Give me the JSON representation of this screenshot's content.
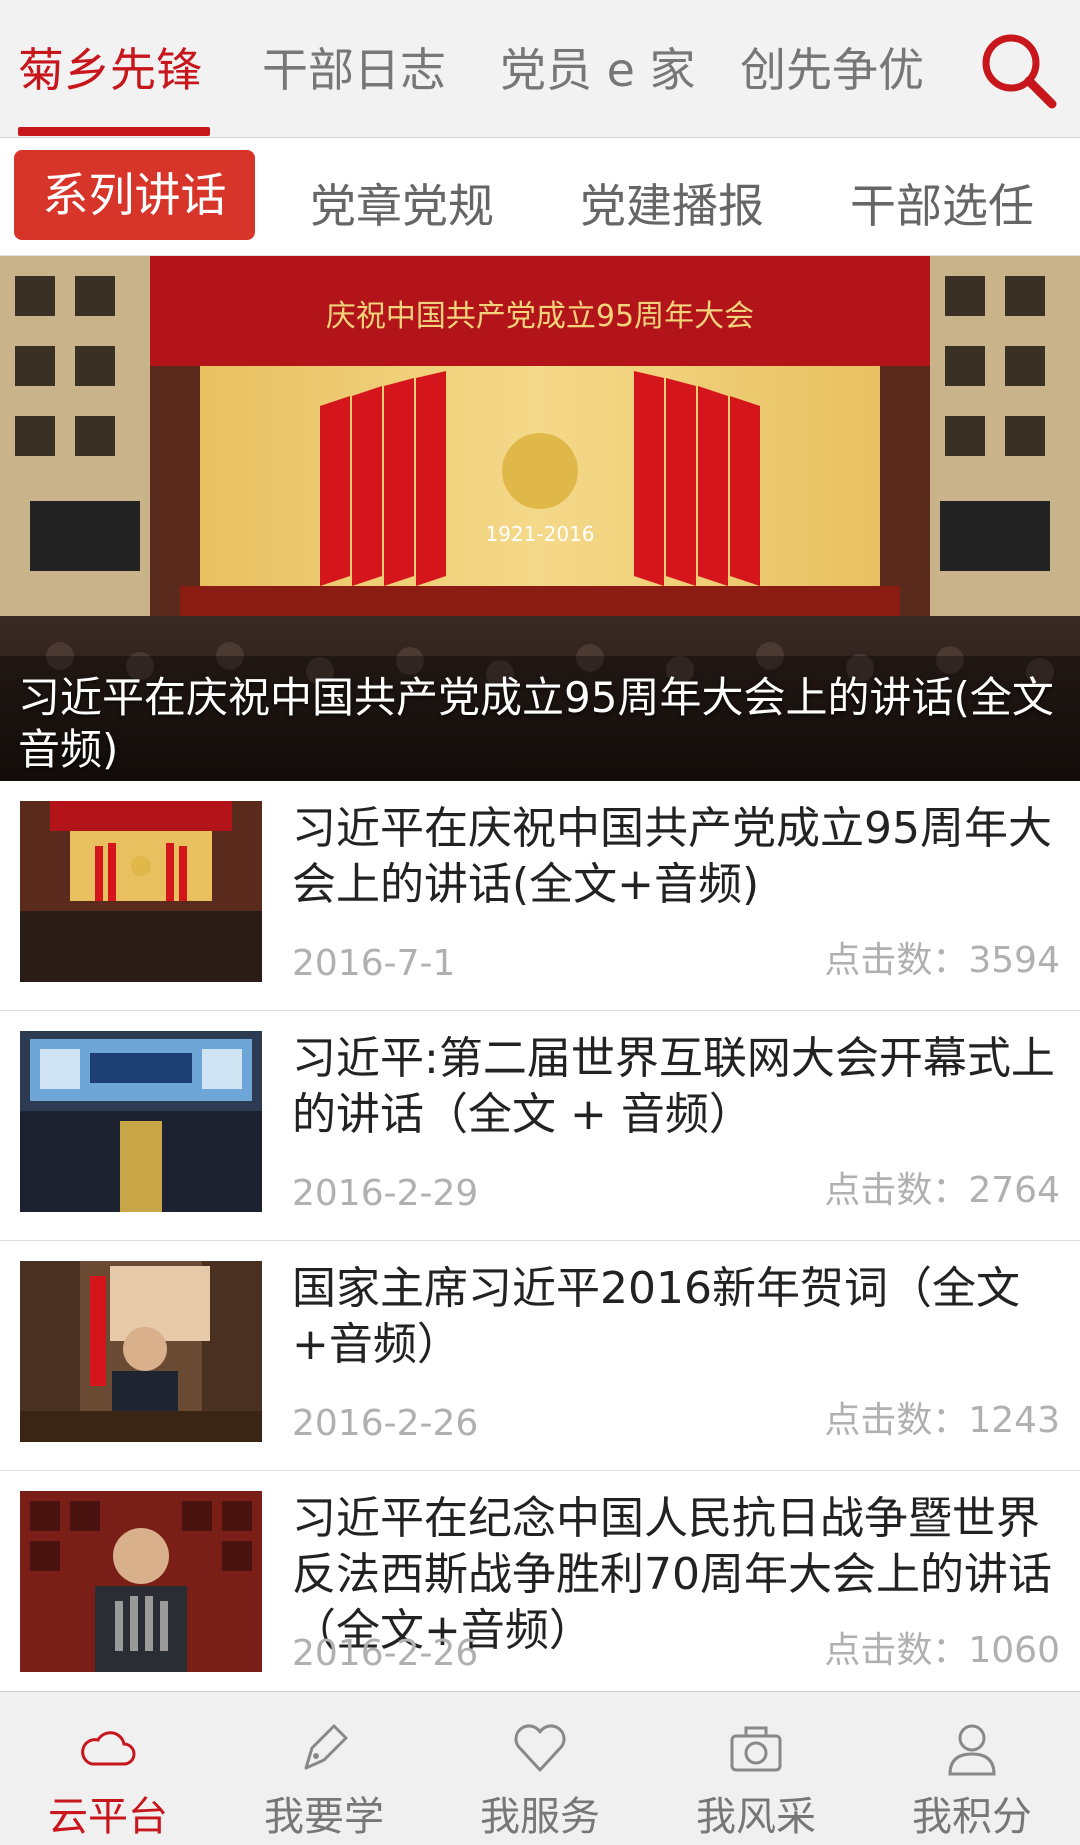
{
  "top_tabs": [
    {
      "label": "菊乡先锋",
      "active": true
    },
    {
      "label": "干部日志",
      "active": false
    },
    {
      "label": "党员 e 家",
      "active": false
    },
    {
      "label": "创先争优",
      "active": false
    }
  ],
  "sub_tabs": [
    {
      "label": "系列讲话",
      "active": true
    },
    {
      "label": "党章党规",
      "active": false
    },
    {
      "label": "党建播报",
      "active": false
    },
    {
      "label": "干部选任",
      "active": false
    }
  ],
  "banner": {
    "title": "习近平在庆祝中国共产党成立95周年大会上的讲话(全文音频)",
    "backdrop_text": "庆祝中国共产党成立95周年大会",
    "emblem_years": "1921-2016",
    "slide_count": 5,
    "active_slide": 0
  },
  "articles": [
    {
      "title": "习近平在庆祝中国共产党成立95周年大会上的讲话(全文+音频)",
      "date": "2016-7-1",
      "clicks": "点击数：3594"
    },
    {
      "title": "习近平:第二届世界互联网大会开幕式上的讲话（全文 + 音频）",
      "date": "2016-2-29",
      "clicks": "点击数：2764"
    },
    {
      "title": "国家主席习近平2016新年贺词（全文+音频）",
      "date": "2016-2-26",
      "clicks": "点击数：1243"
    },
    {
      "title": "习近平在纪念中国人民抗日战争暨世界反法西斯战争胜利70周年大会上的讲话（全文+音频）",
      "date": "2016-2-26",
      "clicks": "点击数：1060"
    }
  ],
  "bottom_nav": [
    {
      "label": "云平台",
      "icon": "cloud-icon",
      "active": true
    },
    {
      "label": "我要学",
      "icon": "pen-icon",
      "active": false
    },
    {
      "label": "我服务",
      "icon": "heart-icon",
      "active": false
    },
    {
      "label": "我风采",
      "icon": "camera-icon",
      "active": false
    },
    {
      "label": "我积分",
      "icon": "user-icon",
      "active": false
    }
  ],
  "colors": {
    "accent": "#c8161d",
    "subtab_active_bg": "#d8352a",
    "muted": "#b0b0b0"
  }
}
